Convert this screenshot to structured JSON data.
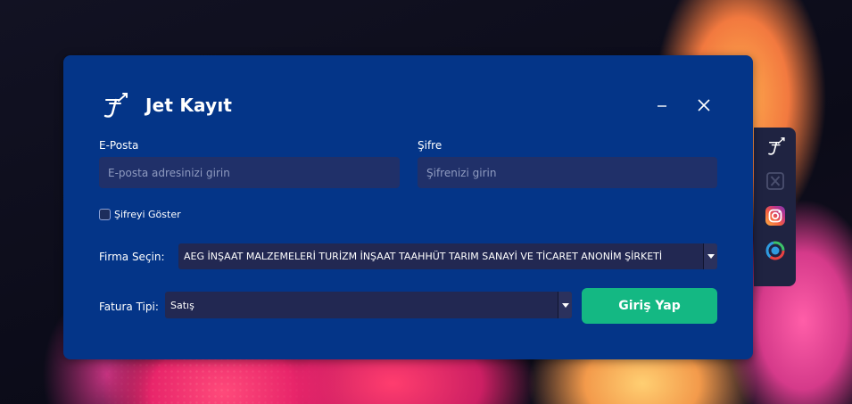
{
  "window": {
    "title": "Jet Kayıt",
    "logo_icon": "jet-kayit-logo-icon",
    "minimize_icon": "minimize-icon",
    "close_icon": "close-icon"
  },
  "email": {
    "label": "E-Posta",
    "placeholder": "E-posta adresinizi girin",
    "value": ""
  },
  "password": {
    "label": "Şifre",
    "placeholder": "Şifrenizi girin",
    "value": ""
  },
  "show_password": {
    "label": "Şifreyi Göster",
    "checked": false
  },
  "company": {
    "label": "Firma Seçin:",
    "selected": "AEG İNŞAAT MALZEMELERİ TURİZM İNŞAAT TAAHHÜT TARIM SANAYİ VE TİCARET ANONİM ŞİRKETİ"
  },
  "invoice_type": {
    "label": "Fatura Tipi:",
    "selected": "Satış"
  },
  "login_button": {
    "label": "Giriş Yap"
  },
  "side_panel": {
    "items": [
      {
        "icon": "jet-kayit-logo-icon"
      },
      {
        "icon": "x-twitter-icon"
      },
      {
        "icon": "instagram-icon"
      },
      {
        "icon": "circular-app-icon"
      }
    ]
  },
  "colors": {
    "window_bg": "#043588",
    "input_bg": "#203069",
    "button_bg": "#14b883",
    "side_panel_bg": "#1f2341"
  }
}
